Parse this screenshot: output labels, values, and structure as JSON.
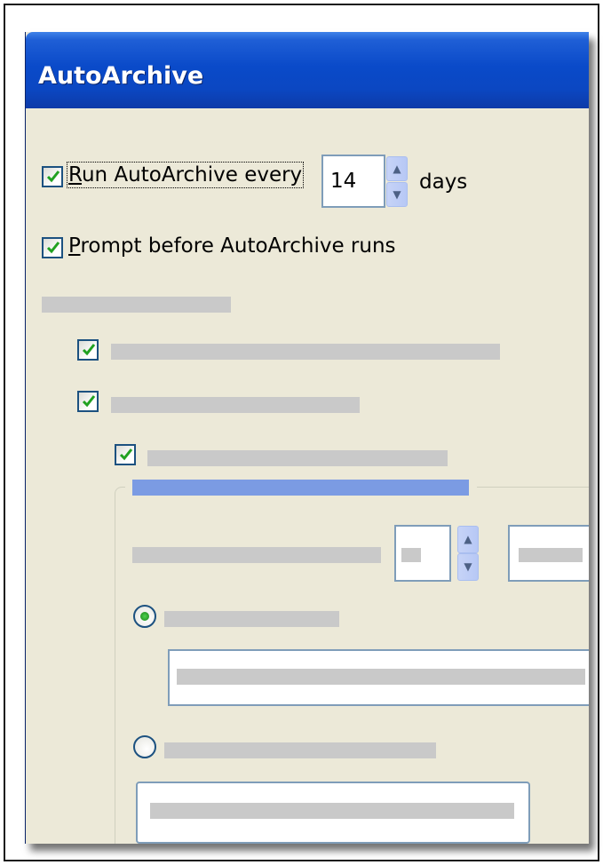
{
  "window": {
    "title": "AutoArchive"
  },
  "options": {
    "run_autoarchive": {
      "label_mnemonic": "R",
      "label_rest": "un AutoArchive every",
      "checked": true
    },
    "interval": {
      "value": "14",
      "unit": "days"
    },
    "prompt_before": {
      "label_mnemonic": "P",
      "label_rest": "rompt before AutoArchive runs",
      "checked": true
    }
  },
  "icons": {
    "checkbox_mark": "check-icon",
    "spin_up": "up-arrow-icon",
    "spin_down": "down-arrow-icon",
    "radio_selected": "radio-dot"
  },
  "colors": {
    "title_bar": "#0b47c2",
    "dialog_bg": "#ece9d8",
    "check_mark": "#21a121",
    "placeholder_bar": "#c9c9c9",
    "placeholder_group_title": "#7b9be3"
  }
}
